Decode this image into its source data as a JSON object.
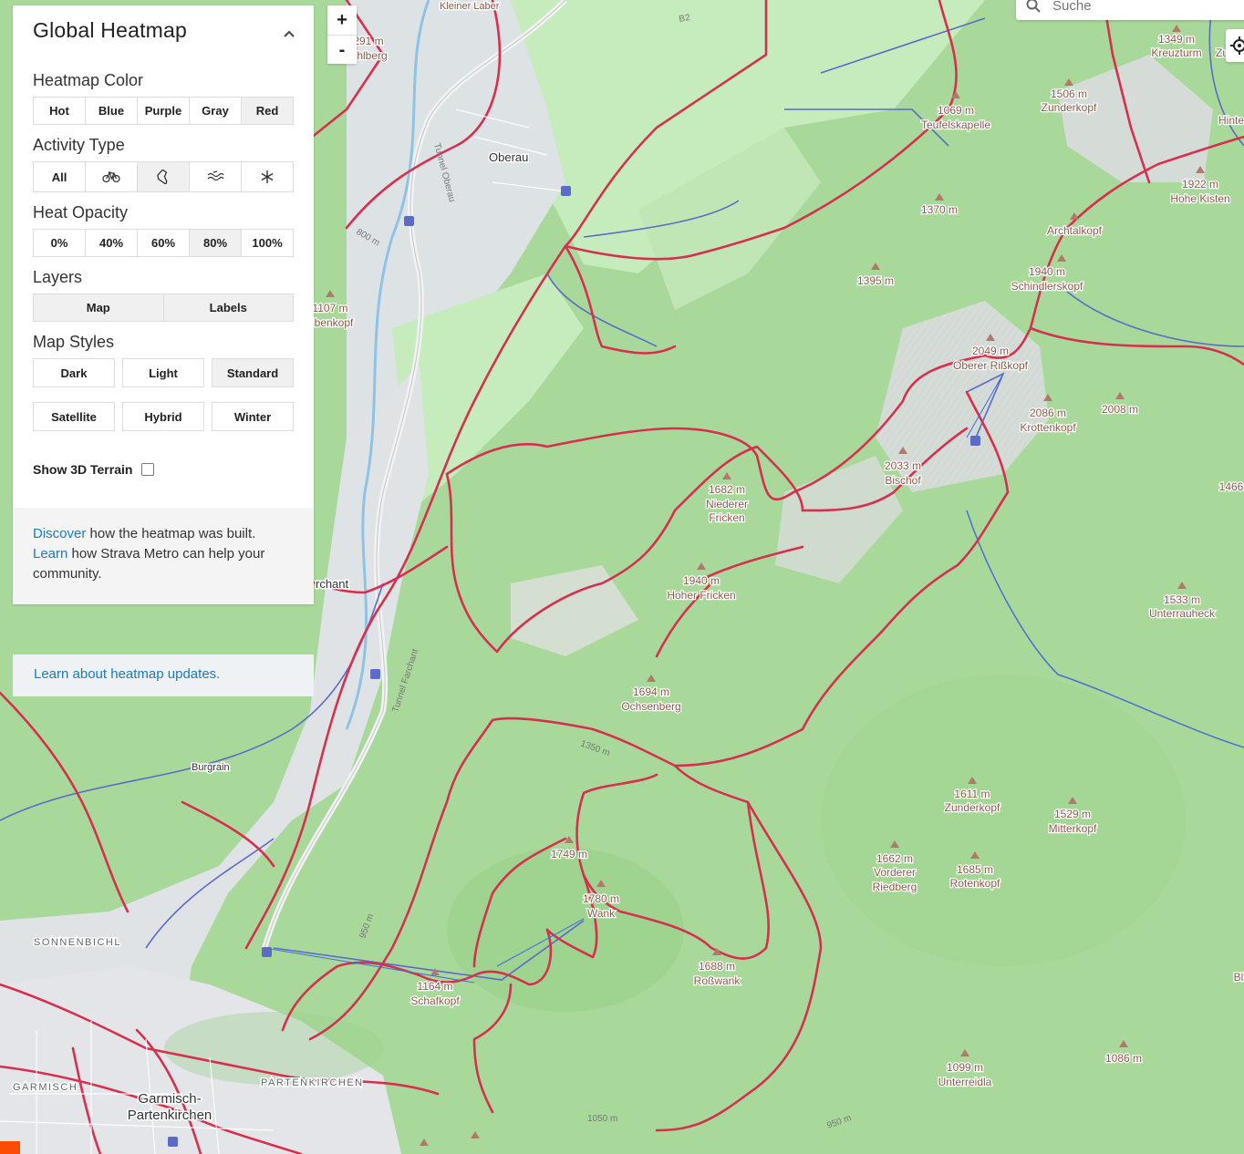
{
  "panel": {
    "title": "Global Heatmap",
    "heatmap_color": {
      "label": "Heatmap Color",
      "options": [
        "Hot",
        "Blue",
        "Purple",
        "Gray",
        "Red"
      ],
      "selected": "Red"
    },
    "activity_type": {
      "label": "Activity Type",
      "options": [
        {
          "label": "All",
          "icon": "text"
        },
        {
          "label": "",
          "icon": "bicycle-icon"
        },
        {
          "label": "",
          "icon": "shoe-icon"
        },
        {
          "label": "",
          "icon": "water-icon"
        },
        {
          "label": "",
          "icon": "snowflake-icon"
        }
      ],
      "selected_index": 2
    },
    "heat_opacity": {
      "label": "Heat Opacity",
      "options": [
        "0%",
        "40%",
        "60%",
        "80%",
        "100%"
      ],
      "selected": "80%"
    },
    "layers": {
      "label": "Layers",
      "options": [
        "Map",
        "Labels"
      ],
      "selected": "Map"
    },
    "map_styles": {
      "label": "Map Styles",
      "options": [
        "Dark",
        "Light",
        "Standard",
        "Satellite",
        "Hybrid",
        "Winter"
      ],
      "selected": "Standard"
    },
    "terrain": {
      "label": "Show 3D Terrain",
      "checked": false
    },
    "info": {
      "discover_link": "Discover",
      "discover_text": " how the heatmap was built.",
      "learn_link": "Learn",
      "learn_text": " how Strava Metro can help your community."
    },
    "updates_link": "Learn about heatmap updates."
  },
  "zoom": {
    "in": "+",
    "out": "-"
  },
  "search": {
    "placeholder": "Suche"
  },
  "map_labels": {
    "towns": [
      "Oberau",
      "Burgrain",
      "Garmisch-",
      "Partenkirchen",
      "SONNENBICHL",
      "GARMISCH",
      "PARTENKIRCHEN"
    ],
    "peaks": [
      {
        "elev": "1349 m",
        "name": "Kreuzturm"
      },
      {
        "elev": "1506 m",
        "name": "Zunderkopf"
      },
      {
        "elev": "1069 m",
        "name": "Teufelskapelle"
      },
      {
        "elev": "1922 m",
        "name": "Hohe Kisten"
      },
      {
        "elev": "1370 m",
        "name": ""
      },
      {
        "elev": "",
        "name": "Archtalkopf"
      },
      {
        "elev": "1395 m",
        "name": ""
      },
      {
        "elev": "1940 m",
        "name": "Schindlerskopf"
      },
      {
        "elev": "2049 m",
        "name": "Oberer Rißkopf"
      },
      {
        "elev": "2086 m",
        "name": "Krottenkopf"
      },
      {
        "elev": "2008 m",
        "name": ""
      },
      {
        "elev": "2033 m",
        "name": "Bischof"
      },
      {
        "elev": "1682 m",
        "name": "Niederer Fricken"
      },
      {
        "elev": "1940 m",
        "name": "Hoher Fricken"
      },
      {
        "elev": "1533 m",
        "name": "Unterrauheck"
      },
      {
        "elev": "1694 m",
        "name": "Ochsenberg"
      },
      {
        "elev": "1611 m",
        "name": "Zunderkopf"
      },
      {
        "elev": "1529 m",
        "name": "Mitterkopf"
      },
      {
        "elev": "1662 m",
        "name": "Vorderer Riedberg"
      },
      {
        "elev": "1685 m",
        "name": "Rotenkopf"
      },
      {
        "elev": "1749 m",
        "name": ""
      },
      {
        "elev": "1780 m",
        "name": "Wank"
      },
      {
        "elev": "1688 m",
        "name": "Roßwank"
      },
      {
        "elev": "1164 m",
        "name": "Schafkopf"
      },
      {
        "elev": "1099 m",
        "name": "Unterreidla"
      },
      {
        "elev": "1086 m",
        "name": ""
      },
      {
        "elev": "1107 m",
        "name": "benkopf"
      },
      {
        "elev": "291 m",
        "name": "hlberg"
      },
      {
        "elev": "1466",
        "name": ""
      }
    ],
    "misc": [
      "Kleiner Laber",
      "B2",
      "Tunnel Oberau",
      "Tunnel Farchant",
      "rchant",
      "800 m",
      "1350 m",
      "950 m",
      "1050 m",
      "950 m",
      "Hinte",
      "Zu",
      "Bl"
    ]
  },
  "colors": {
    "heat": "#d6304f",
    "road": "#5b6bc7",
    "forest": "#a7d89a",
    "meadow": "#c9ebbf",
    "town": "#e4e6ea",
    "rock": "#d6dcd6"
  }
}
